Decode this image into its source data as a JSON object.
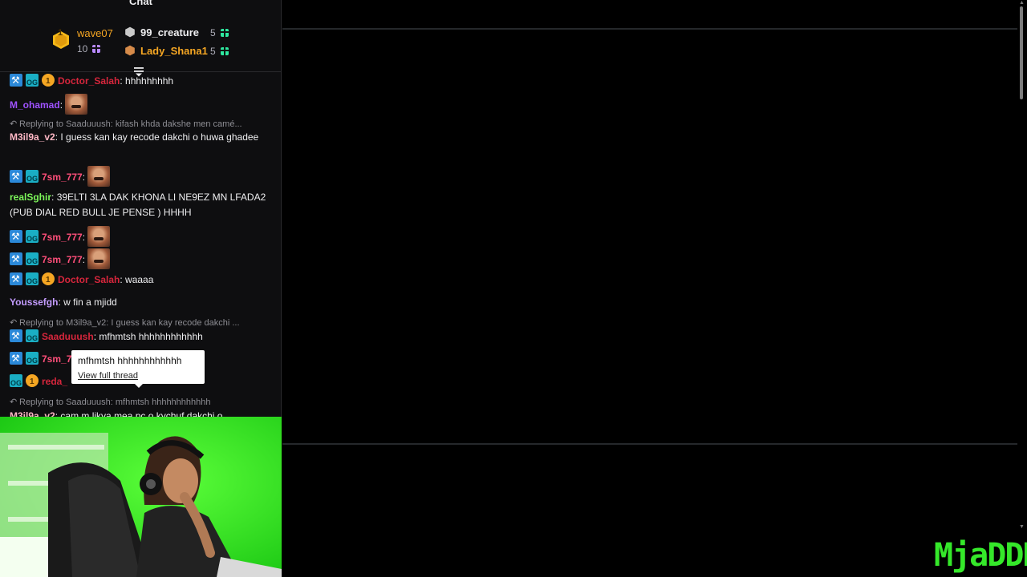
{
  "chat": {
    "title": "Chat",
    "leaderboard": [
      {
        "rank": "1",
        "name": "wave07",
        "count": "10"
      },
      {
        "rank": "2",
        "name": "99_creature",
        "count": "5"
      },
      {
        "rank": "3",
        "name": "Lady_Shana1",
        "count": "5"
      }
    ],
    "messages": [
      {
        "user": "Doctor_Salah",
        "sep": ": ",
        "text": "hhhhhhhhh"
      },
      {
        "user": "M_ohamad",
        "sep": ":",
        "text": ""
      },
      {
        "reply_to": "Replying to Saaduuush: kifash khda dakshe men camé..."
      },
      {
        "user": "M3il9a_v2",
        "sep": ": ",
        "text": "I guess kan kay recode dakchi o huwa ghadee"
      },
      {
        "user": "7sm_777",
        "sep": ":",
        "text": ""
      },
      {
        "user": "realSghir",
        "sep": ": ",
        "text": "39ELTI 3LA DAK KHONA LI NE9EZ MN LFADA2 (PUB DIAL RED BULL JE PENSE ) HHHH"
      },
      {
        "user": "7sm_777",
        "sep": ":",
        "text": ""
      },
      {
        "user": "7sm_777",
        "sep": ":",
        "text": ""
      },
      {
        "user": "Doctor_Salah",
        "sep": ": ",
        "text": "waaaa"
      },
      {
        "user": "Youssefgh",
        "sep": ": ",
        "text": "w fin a mjidd"
      },
      {
        "reply_to": "Replying to M3il9a_v2: I guess kan kay recode dakchi ..."
      },
      {
        "user": "Saaduuush",
        "sep": ": ",
        "text": "mfhmtsh hhhhhhhhhhhh"
      },
      {
        "user": "7sm_7",
        "sep": "",
        "text": ""
      },
      {
        "user": "reda_",
        "sep": "",
        "text": ""
      },
      {
        "reply_to": "Replying to Saaduuush: mfhmtsh hhhhhhhhhhhh"
      },
      {
        "user": "M3il9a_v2",
        "sep": ": ",
        "text": "cam m likya mea pc o kychuf dakchi o"
      }
    ],
    "tooltip": {
      "text": "mfhmtsh hhhhhhhhhhhh",
      "link": "View full thread"
    }
  },
  "stage": {
    "watermark": "MjaDDD"
  },
  "colors": {
    "panel_bg": "#0e0e10",
    "greenscreen": "#22e61c",
    "doctor_salah": "#d6263c",
    "m_ohamad": "#9f52ff",
    "m3il9a": "#ffb8c5",
    "sm777": "#ff4f7a",
    "realsghir": "#7cf55a",
    "youssefgh": "#c49cff",
    "saaduuush": "#d6263c"
  },
  "icons": [
    "collapse-icon",
    "reply-arrow-icon",
    "mod-badge-icon",
    "og-badge-icon",
    "sub-badge-icon",
    "gift-icon",
    "medal-icon"
  ]
}
